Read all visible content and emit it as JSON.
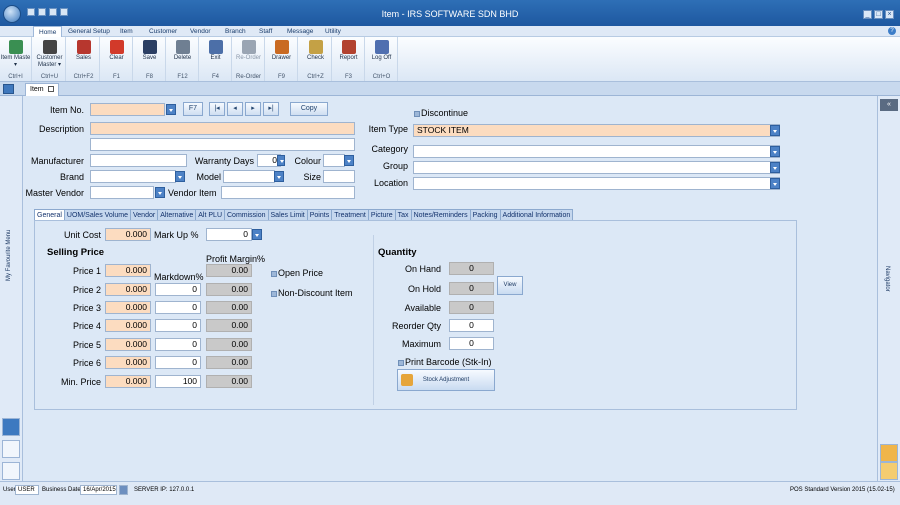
{
  "window": {
    "title": "Item - IRS SOFTWARE SDN BHD"
  },
  "menu_tabs": [
    "Home",
    "General Setup",
    "Item",
    "Customer",
    "Vendor",
    "Branch",
    "Staff",
    "Message",
    "Utility"
  ],
  "ribbon": [
    {
      "label": "Item Maste",
      "sub": "▾",
      "shortcut": "Ctrl+I",
      "icon": "item-master-icon",
      "color": "#3a8f52"
    },
    {
      "label": "Customer",
      "sub": "Master ▾",
      "shortcut": "Ctrl+U",
      "icon": "customer-master-icon",
      "color": "#444"
    },
    {
      "label": "Sales",
      "sub": "",
      "shortcut": "Ctrl+F2",
      "icon": "sales-icon",
      "color": "#b7372e"
    },
    {
      "label": "Clear",
      "sub": "",
      "shortcut": "F1",
      "icon": "clear-icon",
      "color": "#d23a2a"
    },
    {
      "label": "Save",
      "sub": "",
      "shortcut": "F8",
      "icon": "save-icon",
      "color": "#2b3f63"
    },
    {
      "label": "Delete",
      "sub": "",
      "shortcut": "F12",
      "icon": "delete-icon",
      "color": "#6f7f92"
    },
    {
      "label": "Exit",
      "sub": "",
      "shortcut": "F4",
      "icon": "exit-icon",
      "color": "#4c6fa8"
    },
    {
      "label": "Re-Order",
      "sub": "",
      "shortcut": "Re-Order",
      "icon": "reorder-icon",
      "color": "#9aa5b3",
      "disabled": true
    },
    {
      "label": "Drawer",
      "sub": "",
      "shortcut": "F9",
      "icon": "drawer-icon",
      "color": "#c96a22"
    },
    {
      "label": "Check",
      "sub": "",
      "shortcut": "Ctrl+Z",
      "icon": "check-icon",
      "color": "#c4a145"
    },
    {
      "label": "Report",
      "sub": "",
      "shortcut": "F3",
      "icon": "report-icon",
      "color": "#b2422f"
    },
    {
      "label": "Log Off",
      "sub": "",
      "shortcut": "Ctrl+O",
      "icon": "logoff-icon",
      "color": "#4f6fb0"
    }
  ],
  "doc_tab": "Item",
  "form": {
    "item_no_label": "Item No.",
    "f7_label": "F7",
    "copy_label": "Copy",
    "discontinue_label": "Discontinue",
    "description_label": "Description",
    "item_type_label": "Item Type",
    "item_type_value": "STOCK ITEM",
    "manufacturer_label": "Manufacturer",
    "warranty_label": "Warranty Days",
    "warranty_value": "0",
    "colour_label": "Colour",
    "category_label": "Category",
    "group_label": "Group",
    "brand_label": "Brand",
    "model_label": "Model",
    "size_label": "Size",
    "location_label": "Location",
    "master_vendor_label": "Master Vendor",
    "vendor_item_label": "Vendor Item"
  },
  "subtabs": [
    "General",
    "UOM/Sales Volume",
    "Vendor",
    "Alternative",
    "Alt PLU",
    "Commission",
    "Sales Limit",
    "Points",
    "Treatment",
    "Picture",
    "Tax",
    "Notes/Reminders",
    "Packing",
    "Additional Information"
  ],
  "general": {
    "unit_cost_label": "Unit Cost",
    "unit_cost_value": "0.000",
    "markup_label": "Mark Up %",
    "markup_value": "0",
    "selling_price_header": "Selling Price",
    "profit_margin_header": "Profit Margin%",
    "markdown_header": "Markdown%",
    "prices": [
      {
        "label": "Price 1",
        "value": "0.000",
        "markdown": "",
        "margin": "0.00"
      },
      {
        "label": "Price 2",
        "value": "0.000",
        "markdown": "0",
        "margin": "0.00"
      },
      {
        "label": "Price 3",
        "value": "0.000",
        "markdown": "0",
        "margin": "0.00"
      },
      {
        "label": "Price 4",
        "value": "0.000",
        "markdown": "0",
        "margin": "0.00"
      },
      {
        "label": "Price 5",
        "value": "0.000",
        "markdown": "0",
        "margin": "0.00"
      },
      {
        "label": "Price 6",
        "value": "0.000",
        "markdown": "0",
        "margin": "0.00"
      },
      {
        "label": "Min. Price",
        "value": "0.000",
        "markdown": "100",
        "margin": "0.00"
      }
    ],
    "open_price_label": "Open Price",
    "non_discount_label": "Non-Discount Item",
    "quantity_header": "Quantity",
    "on_hand_label": "On Hand",
    "on_hand_value": "0",
    "on_hold_label": "On Hold",
    "on_hold_value": "0",
    "view_label": "View",
    "available_label": "Available",
    "available_value": "0",
    "reorder_label": "Reorder Qty",
    "reorder_value": "0",
    "maximum_label": "Maximum",
    "maximum_value": "0",
    "print_barcode_label": "Print Barcode (Stk-In)",
    "stock_adjustment_label": "Stock Adjustment"
  },
  "left_panel_label": "My Favourite Menu",
  "right_panel_label": "Navigator",
  "status": {
    "user_label": "User",
    "user_value": "USER",
    "business_date_label": "Business Date",
    "business_date_value": "16/Apr/2015",
    "server_ip": "SERVER IP: 127.0.0.1",
    "version": "POS Standard Version 2015 (15.02-15)"
  },
  "colors": {
    "peach": "#fcdcc0",
    "accent": "#1e58a0"
  }
}
